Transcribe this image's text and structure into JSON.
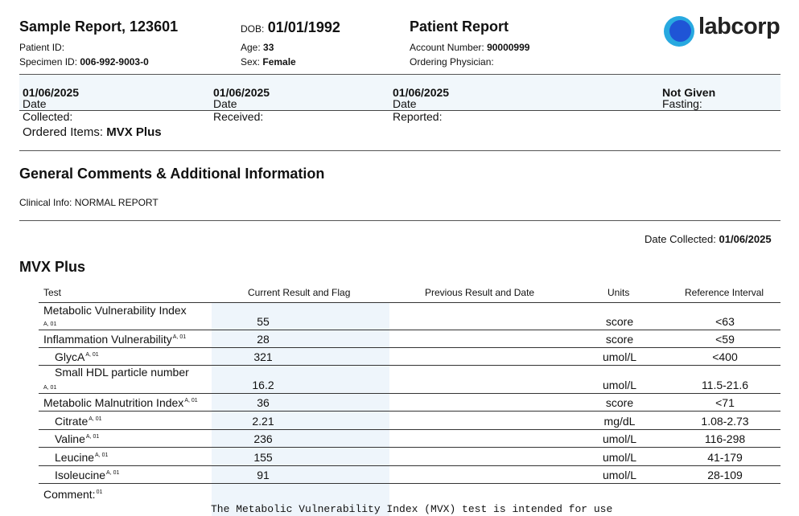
{
  "header": {
    "title": "Sample Report, 123601",
    "patient_id_label": "Patient ID:",
    "specimen_id_label": "Specimen ID:",
    "specimen_id": "006-992-9003-0",
    "dob_label": "DOB:",
    "dob": "01/01/1992",
    "age_label": "Age:",
    "age": "33",
    "sex_label": "Sex:",
    "sex": "Female",
    "report_title": "Patient Report",
    "account_label": "Account Number:",
    "account": "90000999",
    "physician_label": "Ordering Physician:",
    "logo_text": "labcorp"
  },
  "dates": {
    "collected_label": "Date Collected:",
    "collected": "01/06/2025",
    "received_label": "Date Received:",
    "received": "01/06/2025",
    "reported_label": "Date Reported:",
    "reported": "01/06/2025",
    "fasting_label": "Fasting:",
    "fasting": "Not Given"
  },
  "ordered": {
    "label": "Ordered Items:",
    "value": "MVX Plus"
  },
  "comments": {
    "title": "General Comments & Additional Information",
    "clinical": "Clinical Info: NORMAL REPORT"
  },
  "panel": {
    "date_collected_label": "Date Collected:",
    "date_collected": "01/06/2025",
    "title": "MVX Plus",
    "columns": {
      "test": "Test",
      "current": "Current Result and Flag",
      "previous": "Previous Result and Date",
      "units": "Units",
      "reference": "Reference Interval"
    },
    "rows": [
      {
        "test": "Metabolic Vulnerability Index",
        "sup": "A, 01",
        "result": "55",
        "units": "score",
        "ref": "<63"
      },
      {
        "test": "Inflammation Vulnerability",
        "sup": "A, 01",
        "result": "28",
        "units": "score",
        "ref": "<59"
      },
      {
        "test": "GlycA",
        "sup": "A, 01",
        "result": "321",
        "units": "umol/L",
        "ref": "<400"
      },
      {
        "test": "Small HDL particle number",
        "sup": "A, 01",
        "result": "16.2",
        "units": "umol/L",
        "ref": "11.5-21.6"
      },
      {
        "test": "Metabolic Malnutrition Index",
        "sup": "A, 01",
        "result": "36",
        "units": "score",
        "ref": "<71"
      },
      {
        "test": "Citrate",
        "sup": "A, 01",
        "result": "2.21",
        "units": "mg/dL",
        "ref": "1.08-2.73"
      },
      {
        "test": "Valine",
        "sup": "A, 01",
        "result": "236",
        "units": "umol/L",
        "ref": "116-298"
      },
      {
        "test": "Leucine",
        "sup": "A, 01",
        "result": "155",
        "units": "umol/L",
        "ref": "41-179"
      },
      {
        "test": "Isoleucine",
        "sup": "A, 01",
        "result": "91",
        "units": "umol/L",
        "ref": "28-109"
      }
    ],
    "comment_label": "Comment:",
    "comment_sup": "01",
    "comment_text": "The Metabolic Vulnerability Index (MVX) test is intended for use"
  }
}
